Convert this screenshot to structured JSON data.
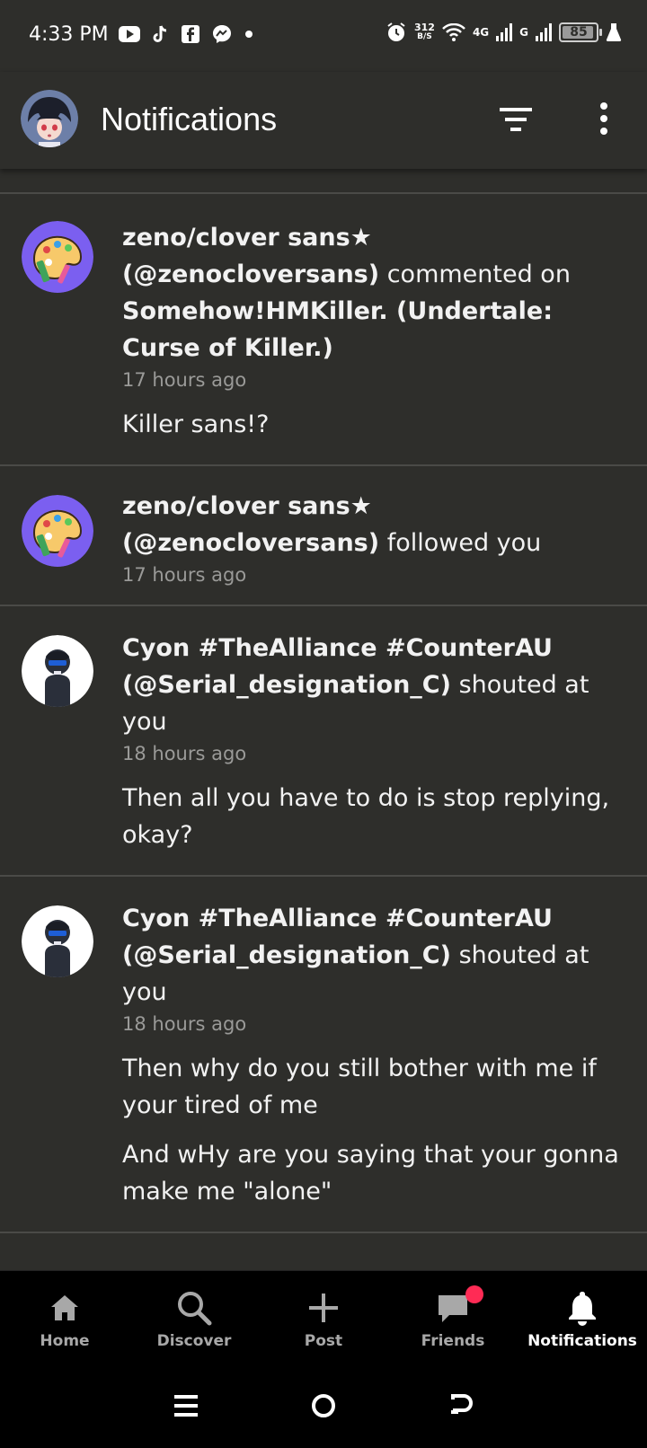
{
  "status_bar": {
    "time": "4:33 PM",
    "data_rate_value": "312",
    "data_rate_unit": "B/S",
    "network_1": "4G",
    "network_2": "G",
    "battery": "85"
  },
  "header": {
    "title": "Notifications"
  },
  "notifications": [
    {
      "name": "zeno/clover sans★",
      "handle": "(@zenocloversans)",
      "action": "commented on",
      "target": "Somehow!HMKiller. (Undertale: Curse of Killer.)",
      "time": "17 hours ago",
      "body": [
        "Killer sans!?"
      ]
    },
    {
      "name": "zeno/clover sans★",
      "handle": "(@zenocloversans)",
      "action": "followed you",
      "time": "17 hours ago"
    },
    {
      "name": "Cyon #TheAlliance #CounterAU",
      "handle": "(@Serial_designation_C)",
      "action": "shouted at you",
      "time": "18 hours ago",
      "body": [
        "Then all you have to do is stop replying, okay?"
      ]
    },
    {
      "name": "Cyon #TheAlliance #CounterAU",
      "handle": "(@Serial_designation_C)",
      "action": "shouted at you",
      "time": "18 hours ago",
      "body": [
        "Then why do you still bother with me if your tired of me",
        "And wHy are you saying that your gonna make me \"alone\""
      ]
    }
  ],
  "nav": {
    "home": "Home",
    "discover": "Discover",
    "post": "Post",
    "friends": "Friends",
    "notifications": "Notifications"
  },
  "colors": {
    "background": "#2e2e2b",
    "divider": "#4a4a47",
    "palette_avatar_bg": "#7b5ff0",
    "badge": "#ff2b55"
  }
}
